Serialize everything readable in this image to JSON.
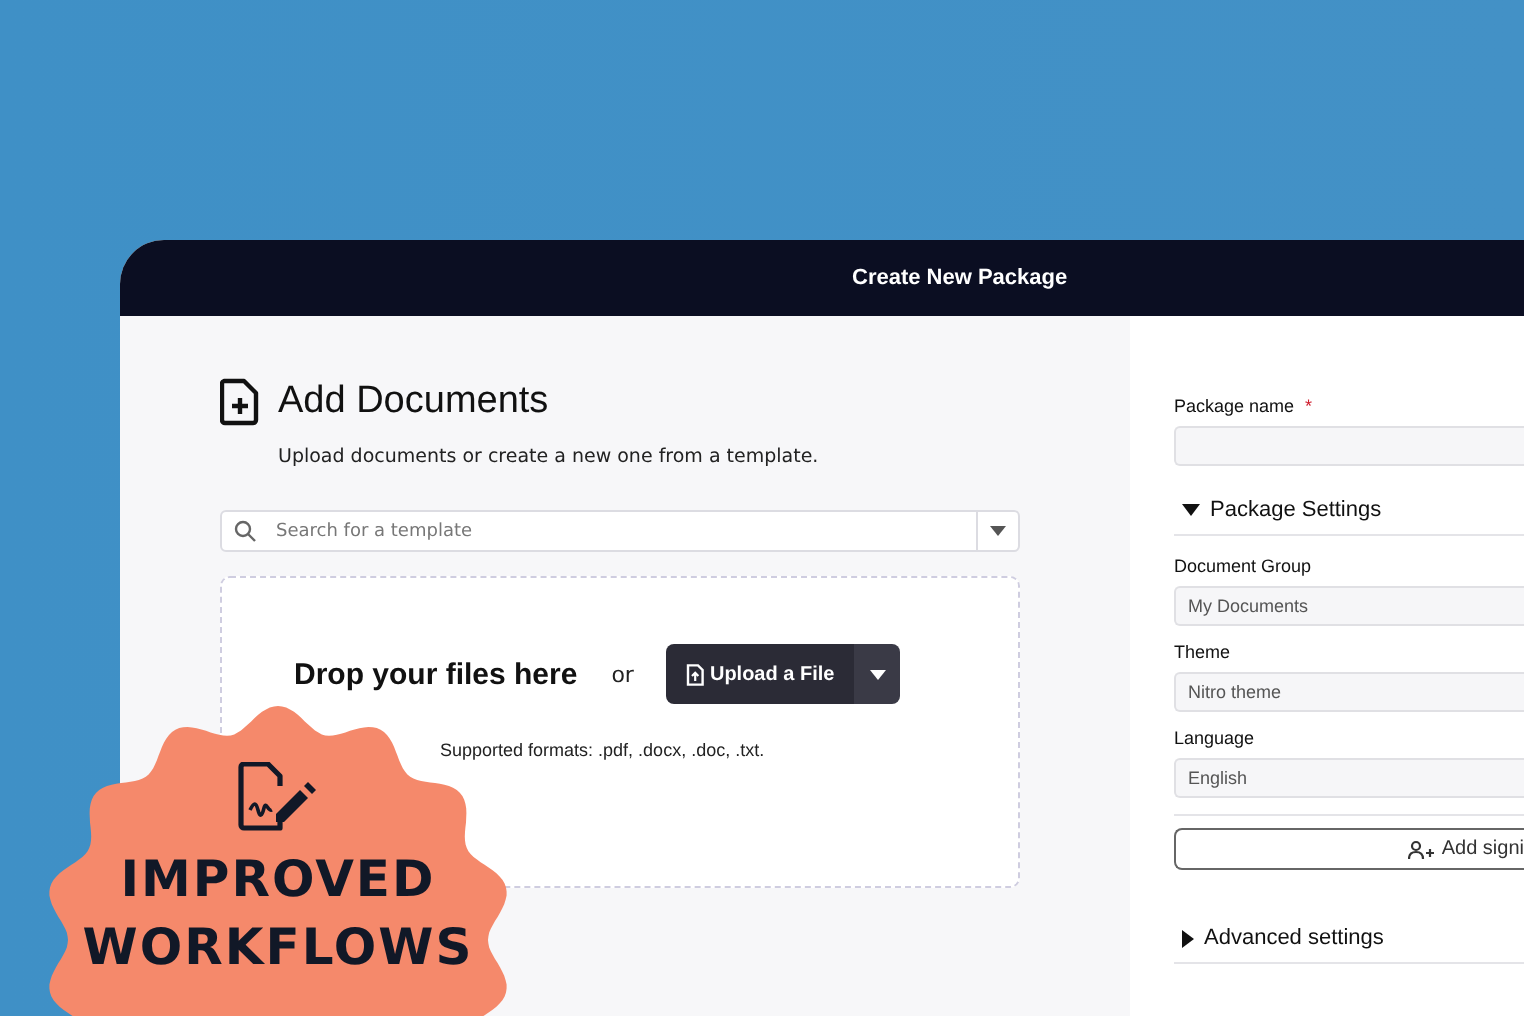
{
  "window": {
    "title": "Create New Package"
  },
  "documents": {
    "title": "Add Documents",
    "subtitle": "Upload documents or create a new one from a template.",
    "search": {
      "placeholder": "Search for a template"
    },
    "dropzone": {
      "prompt": "Drop your files here",
      "or": "or",
      "upload_button": "Upload a File",
      "formats": "Supported formats: .pdf, .docx, .doc, .txt."
    }
  },
  "package": {
    "name_label": "Package name",
    "required_mark": "*",
    "settings": {
      "title": "Package Settings",
      "expanded": true,
      "fields": [
        {
          "label": "Document Group",
          "value": "My Documents"
        },
        {
          "label": "Theme",
          "value": "Nitro theme"
        },
        {
          "label": "Language",
          "value": "English"
        }
      ]
    },
    "add_button": "Add signi",
    "advanced": {
      "title": "Advanced settings",
      "expanded": false
    }
  },
  "badge": {
    "lines": [
      "IMPROVED",
      "WORKFLOWS"
    ]
  }
}
